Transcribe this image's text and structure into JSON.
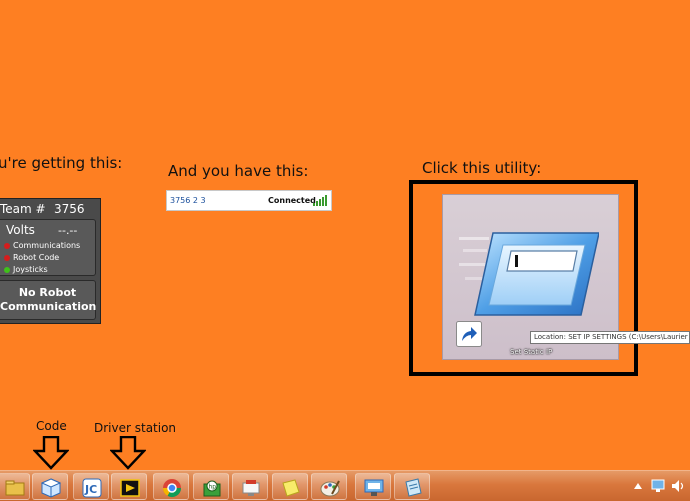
{
  "captions": {
    "getting": "u're getting this:",
    "have": "And you have this:",
    "click": "Click this utility:"
  },
  "driver_station": {
    "team_label": "Team #",
    "team_number": "3756",
    "volts_label": "Volts",
    "volts_value": "--.--",
    "indicators": [
      {
        "label": "Communications",
        "color": "#d61d1d"
      },
      {
        "label": "Robot Code",
        "color": "#d61d1d"
      },
      {
        "label": "Joysticks",
        "color": "#3fc11a"
      }
    ],
    "no_comm": "No Robot Communication"
  },
  "network": {
    "id": "3756 2 3",
    "status": "Connected"
  },
  "utility": {
    "name": "Set Static IP",
    "tooltip": "Location: SET IP SETTINGS (C:\\Users\\Laurier R"
  },
  "annotations": {
    "code": "Code",
    "driver_station": "Driver station"
  },
  "taskbar": {
    "items": [
      {
        "name": "windows-explorer-icon"
      },
      {
        "name": "labview-cube-icon"
      },
      {
        "name": "java-ide-icon"
      },
      {
        "name": "driver-station-icon"
      },
      {
        "name": "chrome-icon"
      },
      {
        "name": "hp-utility-icon"
      },
      {
        "name": "remote-desktop-icon"
      },
      {
        "name": "sticky-notes-icon"
      },
      {
        "name": "paint-icon"
      },
      {
        "name": "network-settings-icon"
      },
      {
        "name": "notepad-icon"
      }
    ]
  }
}
